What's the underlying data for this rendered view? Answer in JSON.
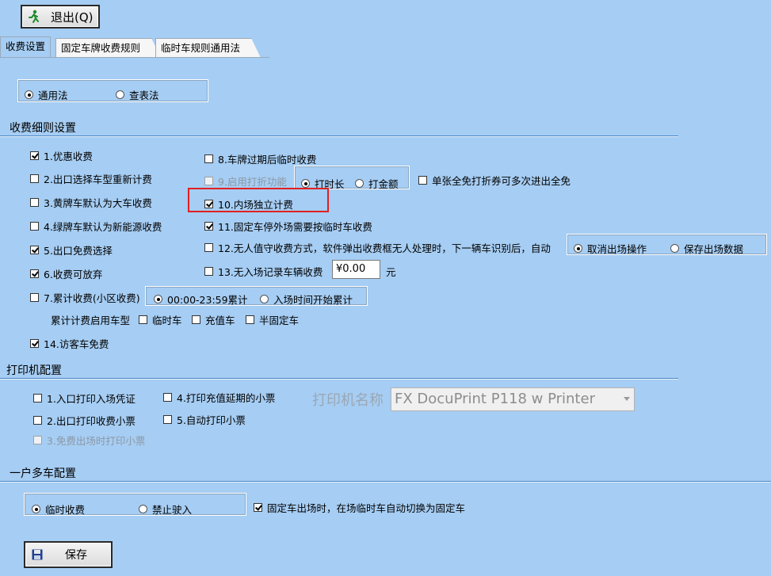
{
  "toolbar": {
    "exit_label": "退出(Q)"
  },
  "tabs": [
    "收费设置",
    "固定车牌收费规则",
    "临时车规则通用法"
  ],
  "mode": {
    "general": "通用法",
    "lookup": "查表法"
  },
  "sections": {
    "fee_detail": "收费细则设置",
    "printer": "打印机配置",
    "multi_car": "一户多车配置"
  },
  "fee_options": {
    "o1": "1.优惠收费",
    "o2": "2.出口选择车型重新计费",
    "o3": "3.黄牌车默认为大车收费",
    "o4": "4.绿牌车默认为新能源收费",
    "o5": "5.出口免费选择",
    "o6": "6.收费可放弃",
    "o7": "7.累计收费(小区收费)",
    "o8": "8.车牌过期后临时收费",
    "o9": "9.启用打折功能",
    "o10": "10.内场独立计费",
    "o11": "11.固定车停外场需要按临时车收费",
    "o12": "12.无人值守收费方式，软件弹出收费框无人处理时，下一辆车识别后，自动",
    "o13": "13.无入场记录车辆收费",
    "o14": "14.访客车免费"
  },
  "discount": {
    "by_time": "打时长",
    "by_amount": "打金额",
    "full_free": "单张全免打折券可多次进出全免"
  },
  "unattended": {
    "cancel": "取消出场操作",
    "save": "保存出场数据"
  },
  "no_entry_fee": {
    "value": "¥0.00",
    "unit": "元"
  },
  "accumulate": {
    "range": "00:00-23:59累计",
    "entry": "入场时间开始累计"
  },
  "accumulate_types": {
    "label": "累计计费启用车型",
    "temp": "临时车",
    "recharge": "充值车",
    "semi": "半固定车"
  },
  "printer": {
    "p1": "1.入口打印入场凭证",
    "p2": "2.出口打印收费小票",
    "p3": "3.免费出场时打印小票",
    "p4": "4.打印充值延期的小票",
    "p5": "5.自动打印小票",
    "name_label": "打印机名称",
    "name_value": "FX DocuPrint P118 w Printer"
  },
  "multi_car": {
    "temp_fee": "临时收费",
    "no_entry": "禁止驶入",
    "auto_switch": "固定车出场时，在场临时车自动切换为固定车"
  },
  "footer": {
    "save_label": "保存"
  }
}
